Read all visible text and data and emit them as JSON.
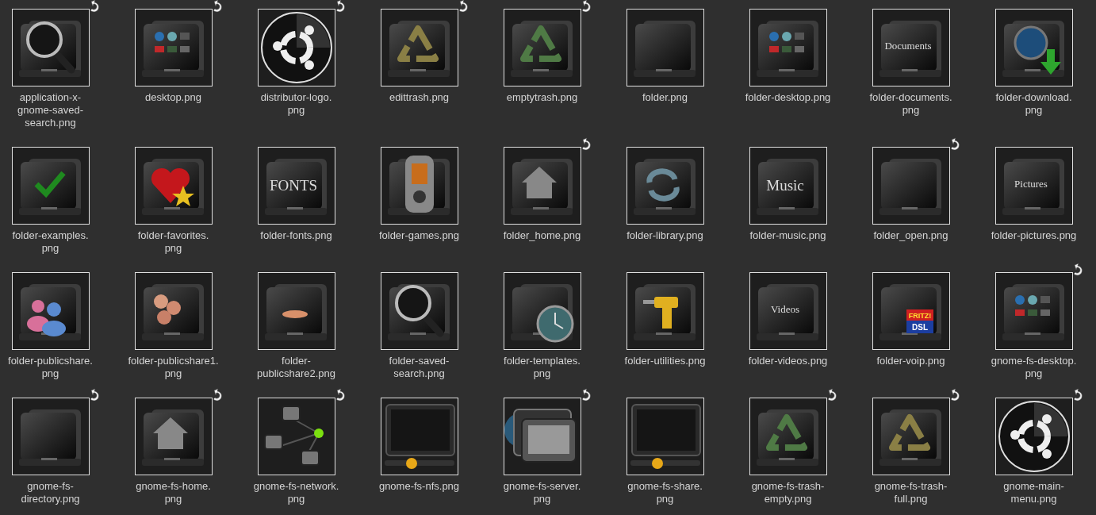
{
  "files": [
    {
      "lines": [
        "application-x-",
        "gnome-saved-",
        "search.png"
      ],
      "symlink": true,
      "kind": "search"
    },
    {
      "lines": [
        "desktop.png"
      ],
      "symlink": true,
      "kind": "desktop"
    },
    {
      "lines": [
        "distributor-logo.",
        "png"
      ],
      "symlink": true,
      "kind": "disc"
    },
    {
      "lines": [
        "edittrash.png"
      ],
      "symlink": true,
      "kind": "recycle",
      "color": "#8a7f45"
    },
    {
      "lines": [
        "emptytrash.png"
      ],
      "symlink": true,
      "kind": "recycle",
      "color": "#4f7a45"
    },
    {
      "lines": [
        "folder.png"
      ],
      "symlink": false,
      "kind": "folder"
    },
    {
      "lines": [
        "folder-desktop.png"
      ],
      "symlink": false,
      "kind": "desktop"
    },
    {
      "lines": [
        "folder-documents.",
        "png"
      ],
      "symlink": false,
      "kind": "label",
      "badge": [
        "Documents"
      ]
    },
    {
      "lines": [
        "folder-download.",
        "png"
      ],
      "symlink": false,
      "kind": "download"
    },
    {
      "lines": [
        "folder-examples.",
        "png"
      ],
      "symlink": false,
      "kind": "check"
    },
    {
      "lines": [
        "folder-favorites.",
        "png"
      ],
      "symlink": false,
      "kind": "heart"
    },
    {
      "lines": [
        "folder-fonts.png"
      ],
      "symlink": false,
      "kind": "label",
      "badge": [
        "FONTS"
      ]
    },
    {
      "lines": [
        "folder-games.png"
      ],
      "symlink": false,
      "kind": "player"
    },
    {
      "lines": [
        "folder_home.png"
      ],
      "symlink": true,
      "kind": "house"
    },
    {
      "lines": [
        "folder-library.png"
      ],
      "symlink": false,
      "kind": "arrows"
    },
    {
      "lines": [
        "folder-music.png"
      ],
      "symlink": false,
      "kind": "label",
      "badge": [
        "Music"
      ]
    },
    {
      "lines": [
        "folder_open.png"
      ],
      "symlink": true,
      "kind": "folder"
    },
    {
      "lines": [
        "folder-pictures.png"
      ],
      "symlink": false,
      "kind": "label",
      "badge": [
        "Pictures"
      ]
    },
    {
      "lines": [
        "folder-publicshare.",
        "png"
      ],
      "symlink": false,
      "kind": "people"
    },
    {
      "lines": [
        "folder-publicshare1.",
        "png"
      ],
      "symlink": false,
      "kind": "heads"
    },
    {
      "lines": [
        "folder-",
        "publicshare2.png"
      ],
      "symlink": false,
      "kind": "hand"
    },
    {
      "lines": [
        "folder-saved-",
        "search.png"
      ],
      "symlink": false,
      "kind": "search"
    },
    {
      "lines": [
        "folder-templates.",
        "png"
      ],
      "symlink": false,
      "kind": "clock"
    },
    {
      "lines": [
        "folder-utilities.png"
      ],
      "symlink": false,
      "kind": "drill"
    },
    {
      "lines": [
        "folder-videos.png"
      ],
      "symlink": false,
      "kind": "label",
      "badge": [
        "Videos"
      ]
    },
    {
      "lines": [
        "folder-voip.png"
      ],
      "symlink": false,
      "kind": "fritz",
      "badge": [
        "FRITZ!",
        "DSL"
      ]
    },
    {
      "lines": [
        "gnome-fs-desktop.",
        "png"
      ],
      "symlink": true,
      "kind": "desktop"
    },
    {
      "lines": [
        "gnome-fs-",
        "directory.png"
      ],
      "symlink": true,
      "kind": "folder"
    },
    {
      "lines": [
        "gnome-fs-home.",
        "png"
      ],
      "symlink": true,
      "kind": "house"
    },
    {
      "lines": [
        "gnome-fs-network.",
        "png"
      ],
      "symlink": true,
      "kind": "network"
    },
    {
      "lines": [
        "gnome-fs-nfs.png"
      ],
      "symlink": false,
      "kind": "monitor"
    },
    {
      "lines": [
        "gnome-fs-server.",
        "png"
      ],
      "symlink": true,
      "kind": "stack"
    },
    {
      "lines": [
        "gnome-fs-share.",
        "png"
      ],
      "symlink": false,
      "kind": "monitor"
    },
    {
      "lines": [
        "gnome-fs-trash-",
        "empty.png"
      ],
      "symlink": true,
      "kind": "recycle",
      "color": "#4f7a45"
    },
    {
      "lines": [
        "gnome-fs-trash-",
        "full.png"
      ],
      "symlink": true,
      "kind": "recycle",
      "color": "#8a7f45"
    },
    {
      "lines": [
        "gnome-main-",
        "menu.png"
      ],
      "symlink": true,
      "kind": "disc"
    }
  ]
}
